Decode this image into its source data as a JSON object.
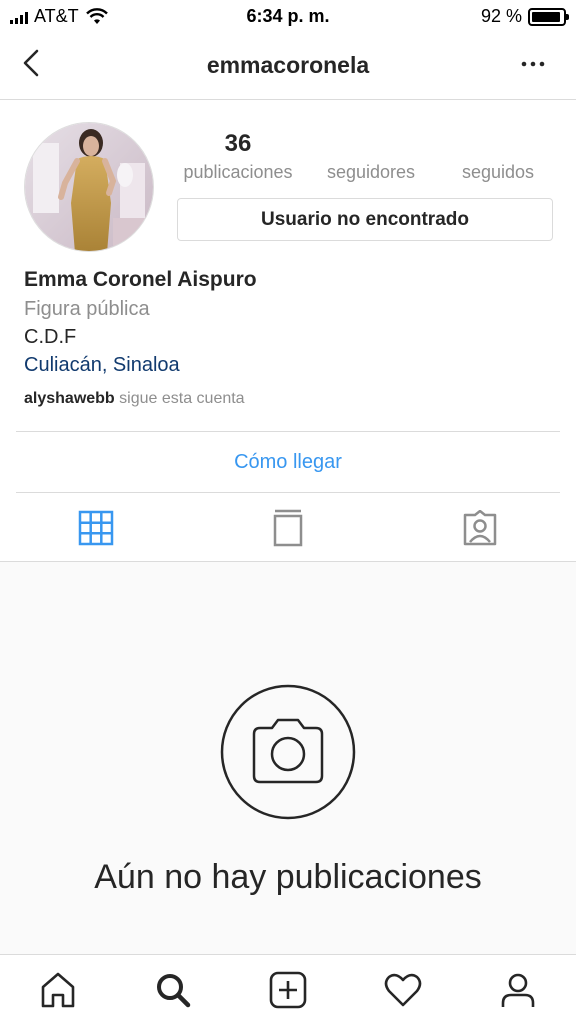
{
  "status_bar": {
    "carrier": "AT&T",
    "time": "6:34 p. m.",
    "battery": "92 %",
    "battery_level": 0.92
  },
  "header": {
    "username": "emmacoronela",
    "back_icon": "chevron-left-icon",
    "more_icon": "more-horizontal-icon"
  },
  "profile": {
    "stats": [
      {
        "value": "36",
        "label": "publicaciones"
      },
      {
        "value": "",
        "label": "seguidores"
      },
      {
        "value": "",
        "label": "seguidos"
      }
    ],
    "status_button": "Usuario no encontrado",
    "name": "Emma Coronel Aispuro",
    "category": "Figura pública",
    "bio": "C.D.F",
    "location": "Culiacán, Sinaloa",
    "followed_by_user": "alyshawebb",
    "followed_by_text": "sigue esta cuenta"
  },
  "directions": "Cómo llegar",
  "tabs": [
    {
      "icon": "grid-icon",
      "active": true
    },
    {
      "icon": "feed-icon",
      "active": false
    },
    {
      "icon": "tagged-icon",
      "active": false
    }
  ],
  "empty": {
    "message": "Aún no hay publicaciones",
    "icon": "camera-icon"
  },
  "colors": {
    "accent": "#3897f0",
    "location": "#113a6e",
    "secondary_text": "#8e8e8e",
    "border": "#dbdbdb"
  },
  "bottom_nav": [
    "home-icon",
    "search-icon",
    "add-icon",
    "heart-icon",
    "profile-icon"
  ]
}
